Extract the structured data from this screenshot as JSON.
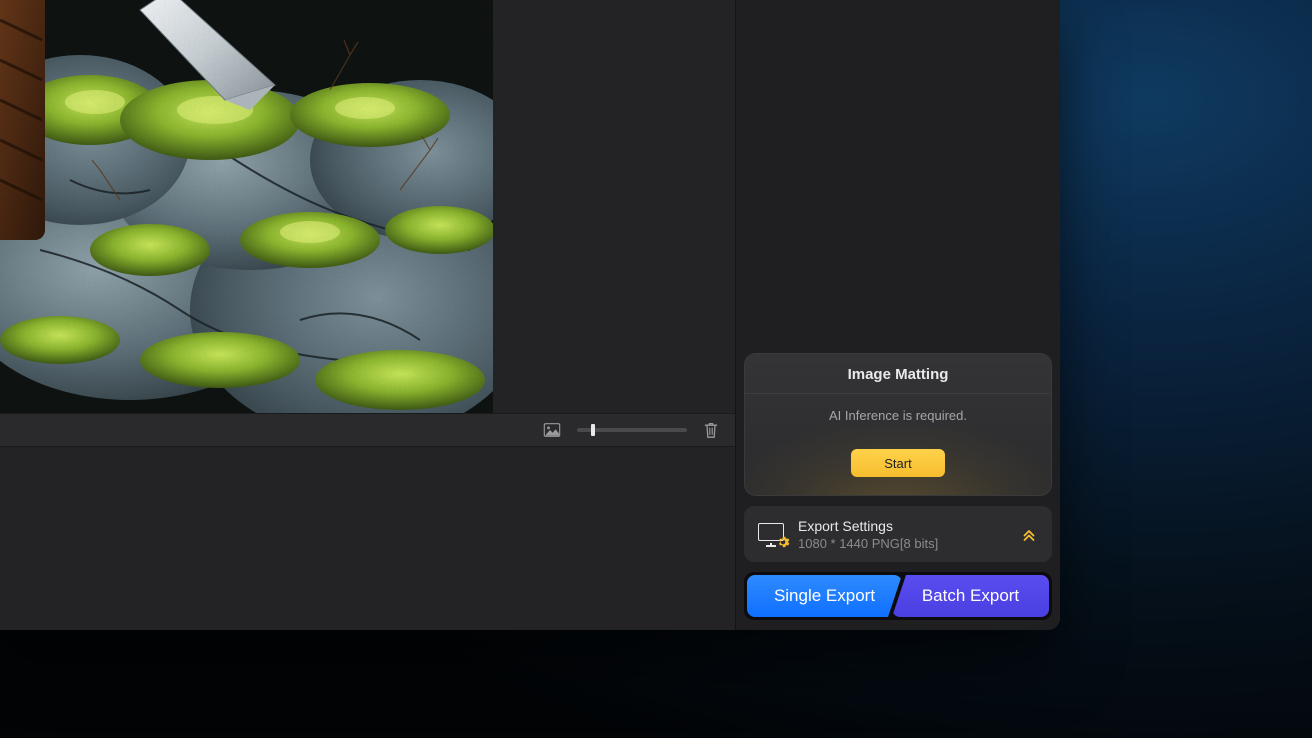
{
  "matting": {
    "title": "Image Matting",
    "message": "AI Inference is required.",
    "start_label": "Start"
  },
  "export_settings": {
    "title": "Export Settings",
    "summary": "1080 * 1440 PNG[8 bits]"
  },
  "export_buttons": {
    "single": "Single Export",
    "batch": "Batch Export"
  },
  "icons": {
    "thumbnail": "thumbnail-icon",
    "trash": "trash-icon",
    "gear": "gear-icon",
    "chevrons_up": "chevrons-up-icon",
    "export_settings_monitor": "monitor-gear-icon"
  },
  "preview_toolbar": {
    "zoom_slider_value": 0.12
  }
}
